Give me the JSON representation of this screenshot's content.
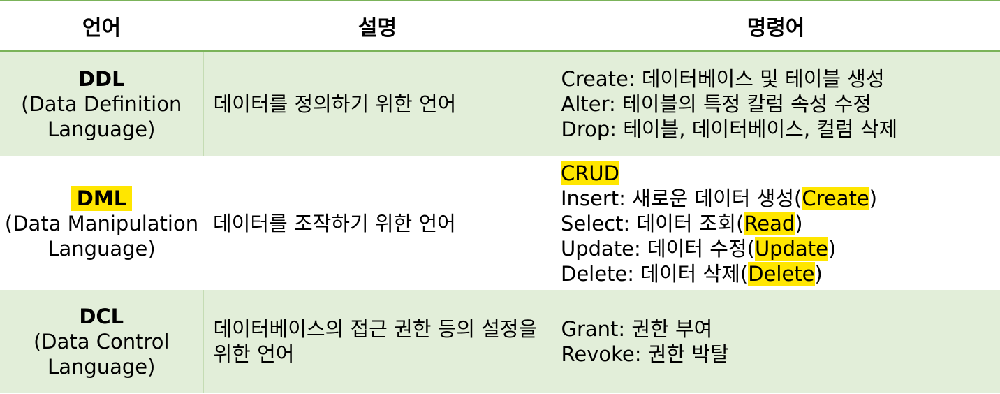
{
  "header": {
    "col_language": "언어",
    "col_description": "설명",
    "col_commands": "명령어"
  },
  "colors": {
    "header_border": "#7bb35a",
    "shaded_row": "#e2eed9",
    "highlight": "#ffe600"
  },
  "rows": [
    {
      "code": "DDL",
      "full_line1": "(Data Definition",
      "full_line2": "Language)",
      "description": "데이터를 정의하기 위한 언어",
      "commands": [
        "Create: 데이터베이스 및 테이블 생성",
        "Alter: 테이블의 특정 칼럼 속성 수정",
        "Drop: 테이블, 데이터베이스, 컬럼 삭제"
      ]
    },
    {
      "code": "DML",
      "full_line1": "(Data Manipulation",
      "full_line2": "Language)",
      "description": "데이터를 조작하기 위한 언어",
      "crud_label": "CRUD",
      "commands": [
        {
          "prefix": "Insert: 새로운 데이터 생성(",
          "highlight": "Create",
          "suffix": ")"
        },
        {
          "prefix": "Select: 데이터 조회(",
          "highlight": "Read",
          "suffix": ")"
        },
        {
          "prefix": "Update: 데이터 수정(",
          "highlight": "Update",
          "suffix": ")"
        },
        {
          "prefix": "Delete: 데이터 삭제(",
          "highlight": "Delete",
          "suffix": ")"
        }
      ]
    },
    {
      "code": "DCL",
      "full_line1": "(Data Control",
      "full_line2": "Language)",
      "description": "데이터베이스의 접근 권한 등의 설정을 위한 언어",
      "commands": [
        "Grant: 권한 부여",
        "Revoke: 권한 박탈"
      ]
    }
  ]
}
